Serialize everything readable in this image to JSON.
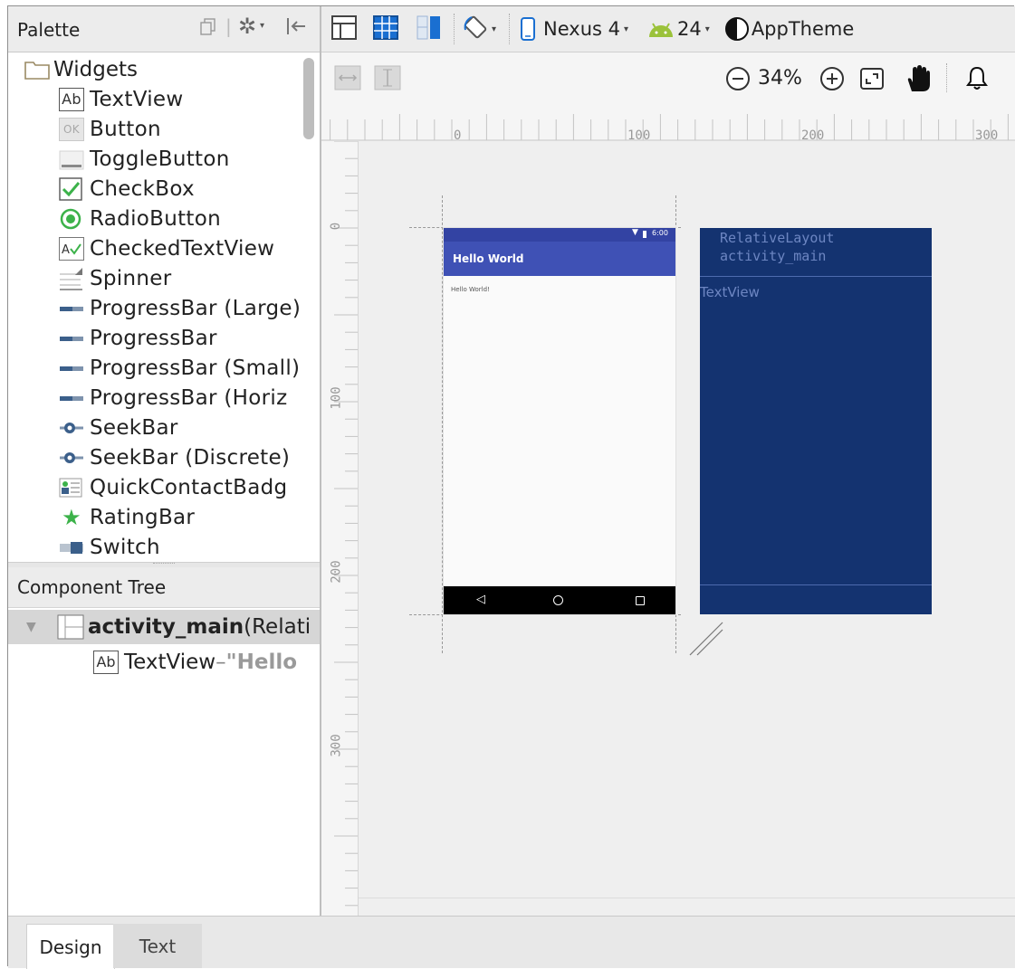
{
  "palette": {
    "title": "Palette",
    "group": "Widgets",
    "items": [
      {
        "label": "TextView"
      },
      {
        "label": "Button"
      },
      {
        "label": "ToggleButton"
      },
      {
        "label": "CheckBox"
      },
      {
        "label": "RadioButton"
      },
      {
        "label": "CheckedTextView"
      },
      {
        "label": "Spinner"
      },
      {
        "label": "ProgressBar (Large)"
      },
      {
        "label": "ProgressBar"
      },
      {
        "label": "ProgressBar (Small)"
      },
      {
        "label": "ProgressBar (Horiz"
      },
      {
        "label": "SeekBar"
      },
      {
        "label": "SeekBar (Discrete)"
      },
      {
        "label": "QuickContactBadg"
      },
      {
        "label": "RatingBar"
      },
      {
        "label": "Switch"
      }
    ]
  },
  "component_tree": {
    "title": "Component Tree",
    "root_name": "activity_main",
    "root_type": " (Relati",
    "child_label": "TextView",
    "child_sep": " – ",
    "child_value": "\"Hello"
  },
  "toolbar": {
    "device": "Nexus 4",
    "api": "24",
    "theme": "AppTheme",
    "zoom": "34%"
  },
  "ruler": {
    "h": [
      "0",
      "100",
      "200",
      "300"
    ],
    "v": [
      "0",
      "100",
      "200",
      "300"
    ]
  },
  "design_view": {
    "app_title": "Hello World",
    "content_text": "Hello World!",
    "status_time": "6:00"
  },
  "blueprint_view": {
    "layout_type": "RelativeLayout",
    "layout_id": "activity_main",
    "textview_label": "TextView"
  },
  "tabs": [
    {
      "label": "Design",
      "active": true
    },
    {
      "label": "Text",
      "active": false
    }
  ],
  "colors": {
    "app_bar": "#3f51b5",
    "blueprint_bg": "#143370",
    "blueprint_text": "#6d86c2",
    "nav_bar": "#000000",
    "check_green": "#3cb24a",
    "android_green": "#9bc23a"
  }
}
